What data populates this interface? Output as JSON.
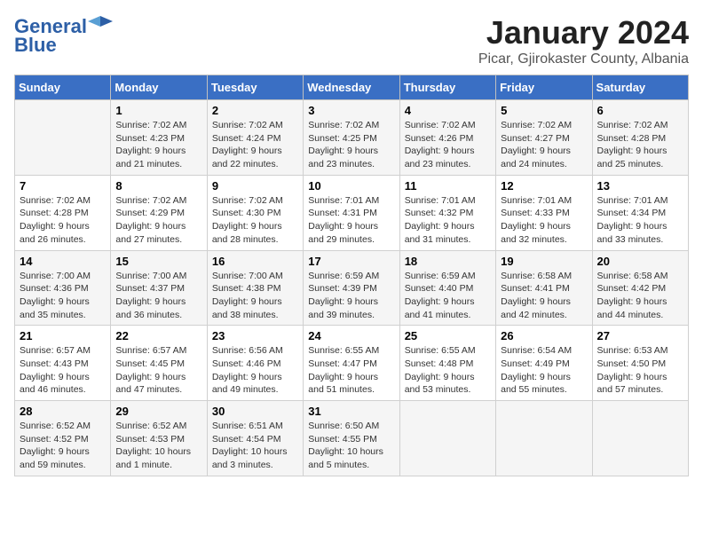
{
  "logo": {
    "general": "General",
    "blue": "Blue"
  },
  "title": "January 2024",
  "subtitle": "Picar, Gjirokaster County, Albania",
  "weekdays": [
    "Sunday",
    "Monday",
    "Tuesday",
    "Wednesday",
    "Thursday",
    "Friday",
    "Saturday"
  ],
  "weeks": [
    [
      {
        "day": "",
        "sunrise": "",
        "sunset": "",
        "daylight": ""
      },
      {
        "day": "1",
        "sunrise": "Sunrise: 7:02 AM",
        "sunset": "Sunset: 4:23 PM",
        "daylight": "Daylight: 9 hours and 21 minutes."
      },
      {
        "day": "2",
        "sunrise": "Sunrise: 7:02 AM",
        "sunset": "Sunset: 4:24 PM",
        "daylight": "Daylight: 9 hours and 22 minutes."
      },
      {
        "day": "3",
        "sunrise": "Sunrise: 7:02 AM",
        "sunset": "Sunset: 4:25 PM",
        "daylight": "Daylight: 9 hours and 23 minutes."
      },
      {
        "day": "4",
        "sunrise": "Sunrise: 7:02 AM",
        "sunset": "Sunset: 4:26 PM",
        "daylight": "Daylight: 9 hours and 23 minutes."
      },
      {
        "day": "5",
        "sunrise": "Sunrise: 7:02 AM",
        "sunset": "Sunset: 4:27 PM",
        "daylight": "Daylight: 9 hours and 24 minutes."
      },
      {
        "day": "6",
        "sunrise": "Sunrise: 7:02 AM",
        "sunset": "Sunset: 4:28 PM",
        "daylight": "Daylight: 9 hours and 25 minutes."
      }
    ],
    [
      {
        "day": "7",
        "sunrise": "Sunrise: 7:02 AM",
        "sunset": "Sunset: 4:28 PM",
        "daylight": "Daylight: 9 hours and 26 minutes."
      },
      {
        "day": "8",
        "sunrise": "Sunrise: 7:02 AM",
        "sunset": "Sunset: 4:29 PM",
        "daylight": "Daylight: 9 hours and 27 minutes."
      },
      {
        "day": "9",
        "sunrise": "Sunrise: 7:02 AM",
        "sunset": "Sunset: 4:30 PM",
        "daylight": "Daylight: 9 hours and 28 minutes."
      },
      {
        "day": "10",
        "sunrise": "Sunrise: 7:01 AM",
        "sunset": "Sunset: 4:31 PM",
        "daylight": "Daylight: 9 hours and 29 minutes."
      },
      {
        "day": "11",
        "sunrise": "Sunrise: 7:01 AM",
        "sunset": "Sunset: 4:32 PM",
        "daylight": "Daylight: 9 hours and 31 minutes."
      },
      {
        "day": "12",
        "sunrise": "Sunrise: 7:01 AM",
        "sunset": "Sunset: 4:33 PM",
        "daylight": "Daylight: 9 hours and 32 minutes."
      },
      {
        "day": "13",
        "sunrise": "Sunrise: 7:01 AM",
        "sunset": "Sunset: 4:34 PM",
        "daylight": "Daylight: 9 hours and 33 minutes."
      }
    ],
    [
      {
        "day": "14",
        "sunrise": "Sunrise: 7:00 AM",
        "sunset": "Sunset: 4:36 PM",
        "daylight": "Daylight: 9 hours and 35 minutes."
      },
      {
        "day": "15",
        "sunrise": "Sunrise: 7:00 AM",
        "sunset": "Sunset: 4:37 PM",
        "daylight": "Daylight: 9 hours and 36 minutes."
      },
      {
        "day": "16",
        "sunrise": "Sunrise: 7:00 AM",
        "sunset": "Sunset: 4:38 PM",
        "daylight": "Daylight: 9 hours and 38 minutes."
      },
      {
        "day": "17",
        "sunrise": "Sunrise: 6:59 AM",
        "sunset": "Sunset: 4:39 PM",
        "daylight": "Daylight: 9 hours and 39 minutes."
      },
      {
        "day": "18",
        "sunrise": "Sunrise: 6:59 AM",
        "sunset": "Sunset: 4:40 PM",
        "daylight": "Daylight: 9 hours and 41 minutes."
      },
      {
        "day": "19",
        "sunrise": "Sunrise: 6:58 AM",
        "sunset": "Sunset: 4:41 PM",
        "daylight": "Daylight: 9 hours and 42 minutes."
      },
      {
        "day": "20",
        "sunrise": "Sunrise: 6:58 AM",
        "sunset": "Sunset: 4:42 PM",
        "daylight": "Daylight: 9 hours and 44 minutes."
      }
    ],
    [
      {
        "day": "21",
        "sunrise": "Sunrise: 6:57 AM",
        "sunset": "Sunset: 4:43 PM",
        "daylight": "Daylight: 9 hours and 46 minutes."
      },
      {
        "day": "22",
        "sunrise": "Sunrise: 6:57 AM",
        "sunset": "Sunset: 4:45 PM",
        "daylight": "Daylight: 9 hours and 47 minutes."
      },
      {
        "day": "23",
        "sunrise": "Sunrise: 6:56 AM",
        "sunset": "Sunset: 4:46 PM",
        "daylight": "Daylight: 9 hours and 49 minutes."
      },
      {
        "day": "24",
        "sunrise": "Sunrise: 6:55 AM",
        "sunset": "Sunset: 4:47 PM",
        "daylight": "Daylight: 9 hours and 51 minutes."
      },
      {
        "day": "25",
        "sunrise": "Sunrise: 6:55 AM",
        "sunset": "Sunset: 4:48 PM",
        "daylight": "Daylight: 9 hours and 53 minutes."
      },
      {
        "day": "26",
        "sunrise": "Sunrise: 6:54 AM",
        "sunset": "Sunset: 4:49 PM",
        "daylight": "Daylight: 9 hours and 55 minutes."
      },
      {
        "day": "27",
        "sunrise": "Sunrise: 6:53 AM",
        "sunset": "Sunset: 4:50 PM",
        "daylight": "Daylight: 9 hours and 57 minutes."
      }
    ],
    [
      {
        "day": "28",
        "sunrise": "Sunrise: 6:52 AM",
        "sunset": "Sunset: 4:52 PM",
        "daylight": "Daylight: 9 hours and 59 minutes."
      },
      {
        "day": "29",
        "sunrise": "Sunrise: 6:52 AM",
        "sunset": "Sunset: 4:53 PM",
        "daylight": "Daylight: 10 hours and 1 minute."
      },
      {
        "day": "30",
        "sunrise": "Sunrise: 6:51 AM",
        "sunset": "Sunset: 4:54 PM",
        "daylight": "Daylight: 10 hours and 3 minutes."
      },
      {
        "day": "31",
        "sunrise": "Sunrise: 6:50 AM",
        "sunset": "Sunset: 4:55 PM",
        "daylight": "Daylight: 10 hours and 5 minutes."
      },
      {
        "day": "",
        "sunrise": "",
        "sunset": "",
        "daylight": ""
      },
      {
        "day": "",
        "sunrise": "",
        "sunset": "",
        "daylight": ""
      },
      {
        "day": "",
        "sunrise": "",
        "sunset": "",
        "daylight": ""
      }
    ]
  ]
}
